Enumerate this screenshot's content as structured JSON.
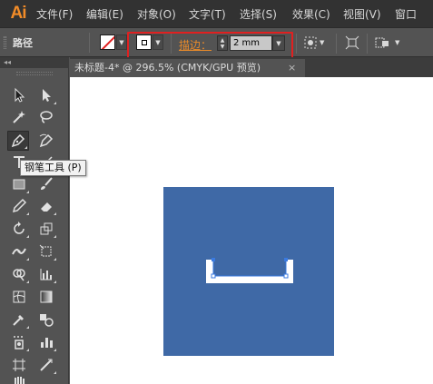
{
  "app": {
    "logo": "Ai"
  },
  "menu": {
    "items": [
      "文件(F)",
      "编辑(E)",
      "对象(O)",
      "文字(T)",
      "选择(S)",
      "效果(C)",
      "视图(V)",
      "窗口"
    ]
  },
  "control_bar": {
    "object_label": "路径",
    "stroke_label": "描边：",
    "stroke_value": "2 mm",
    "highlight_color": "#e02020",
    "stroke_label_color": "#e88a2a"
  },
  "document": {
    "tab_title": "未标题-4* @ 296.5% (CMYK/GPU 预览)",
    "close_icon": "×",
    "artboard_color": "#3f69a6"
  },
  "tool_panel": {
    "collapse_icon": "◂◂",
    "tooltip": "钢笔工具 (P)",
    "tools": [
      "selection-tool-icon",
      "direct-selection-tool-icon",
      "magic-wand-tool-icon",
      "lasso-tool-icon",
      "pen-tool-icon",
      "curvature-tool-icon",
      "type-tool-icon",
      "line-tool-icon",
      "rectangle-tool-icon",
      "paintbrush-tool-icon",
      "pencil-tool-icon",
      "eraser-tool-icon",
      "rotate-tool-icon",
      "scale-tool-icon",
      "width-tool-icon",
      "free-transform-tool-icon",
      "shape-builder-tool-icon",
      "chart-tool-icon",
      "mesh-tool-icon",
      "gradient-tool-icon",
      "eyedropper-tool-icon",
      "blend-tool-icon",
      "symbol-sprayer-tool-icon",
      "column-graph-tool-icon",
      "artboard-tool-icon",
      "slice-tool-icon"
    ]
  }
}
